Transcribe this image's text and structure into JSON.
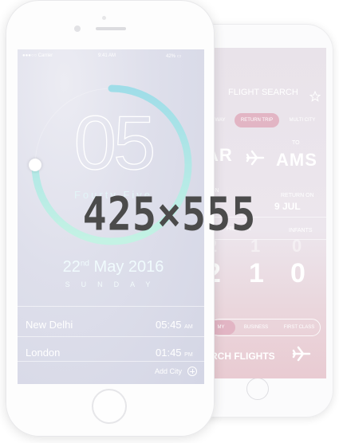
{
  "flight": {
    "title": "FLIGHT SEARCH",
    "trip_tabs": [
      "WAY",
      "RETURN TRIP",
      "MULTI CITY"
    ],
    "from_label": "OM",
    "from_code": "AR",
    "to_label": "TO",
    "to_code": "AMS",
    "depart_label": "T ON",
    "return_label": "RETURN ON",
    "return_date": "9 JUL",
    "passenger_labels": [
      "HILDREN",
      "INFANTS"
    ],
    "picker_top": [
      "2",
      "1",
      "0"
    ],
    "picker_values": [
      "2",
      "1",
      "0"
    ],
    "class_tabs": [
      "MY",
      "BUSINESS",
      "FIRST CLASS"
    ],
    "search_label": "RCH FLIGHTS",
    "accent": "#e2b5c4"
  },
  "clock": {
    "status_carrier": "Carrier",
    "status_time": "9:41 AM",
    "status_battery": "42%",
    "hour": "05",
    "minute_word": "Fourty Five",
    "date_day": "22",
    "date_suffix": "nd",
    "date_rest": "May 2016",
    "weekday": "SUNDAY",
    "cities": [
      {
        "name": "New Delhi",
        "time": "05:45",
        "ampm": "AM"
      },
      {
        "name": "London",
        "time": "01:45",
        "ampm": "PM"
      }
    ],
    "add_city": "Add City",
    "ring_progress": 0.75,
    "ring_color_start": "#a9e3ec",
    "ring_color_end": "#bff0e4"
  },
  "overlay_text": "425×555"
}
